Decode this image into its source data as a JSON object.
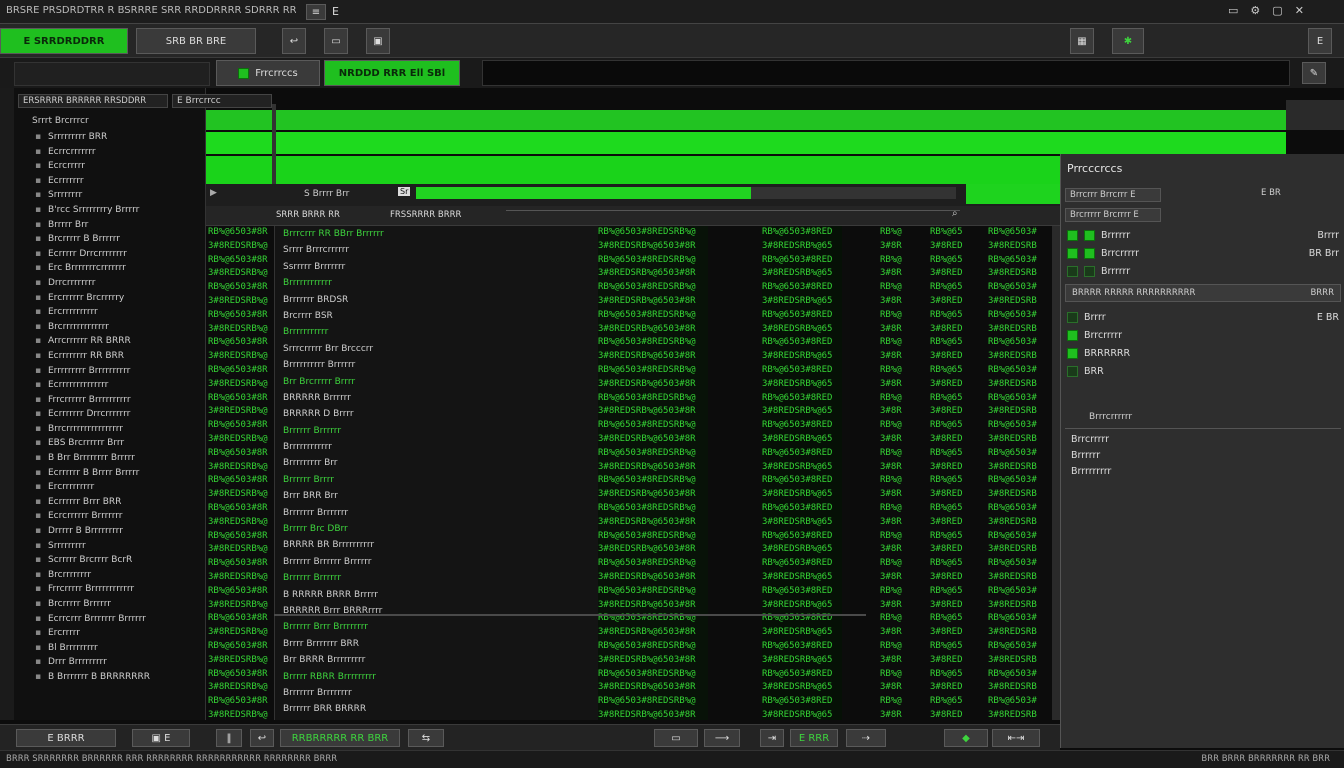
{
  "window": {
    "title": "BRSRE PRSDRDTRR R BSRRRE SRR RRDDRRRR SDRRR RRRBRR",
    "menu_extra": "E"
  },
  "toolbar": {
    "primary_label": "E SRRDRDDRR",
    "search_label": "SRB BR BRE",
    "zoom_label": "E"
  },
  "tabs": [
    {
      "label": "Frrcrrccs"
    },
    {
      "label": "NRDDD RRR Ell SBl"
    }
  ],
  "left_panel": {
    "header": "ERSRRRR BRRRRR RRSDDRR",
    "header_right": "E Brrcrrcc",
    "subheader": "Srrrt Brcrrrcr",
    "items": [
      "Srrrrrrrrr BRR",
      "Ecrrcrrrrrrr",
      "Ecrcrrrrr",
      "Ecrrrrrrr",
      "Srrrrrrrr",
      "B'rcc Srrrrrrrry Brrrrr",
      "Brrrrr Brr",
      "Brcrrrrr B Brrrrrr",
      "Ecrrrrr Drrcrrrrrrrr",
      "Erc Brrrrrrrcrrrrrrr",
      "Drrcrrrrrrrr",
      "Ercrrrrrr Brcrrrrry",
      "Ercrrrrrrrrrr",
      "Brcrrrrrrrrrrrrr",
      "Arrcrrrrrr RR BRRR",
      "Ecrrrrrrrr RR BRR",
      "Errrrrrrrr Brrrrrrrrrr",
      "Ecrrrrrrrrrrrrrr",
      "Frrcrrrrrr Brrrrrrrrrr",
      "Ecrrrrrrr Drrcrrrrrrr",
      "Brrcrrrrrrrrrrrrrrrr",
      "EBS Brcrrrrrr Brrr",
      "B Brr Brrrrrrrr Brrrrr",
      "Ecrrrrrr B Brrrr Brrrrr",
      "Ercrrrrrrrrr",
      "Ecrrrrrr Brrr BRR",
      "Ecrcrrrrrr Brrrrrrr",
      "Drrrrr B Brrrrrrrrr",
      "Srrrrrrrrr",
      "Scrrrrr Brcrrrr BcrR",
      "Brcrrrrrrrr",
      "Frrcrrrrr Brrrrrrrrrrrr",
      "Brcrrrrr Brrrrrr",
      "Ecrrcrrr Brrrrrrr Brrrrrr",
      "Ercrrrrr",
      "Bl Brrrrrrrrr",
      "Drrr Brrrrrrrrr",
      "B Brrrrrrr B BRRRRRRR"
    ]
  },
  "progress": {
    "label": "S Brrrr Brr",
    "value": 0.62,
    "left_label": "Sr"
  },
  "center": {
    "sort_label": "SRRR BRRR RR",
    "filter_label": "FRSSRRRR BRRR",
    "rows": [
      "Brrrcrrr RR BBrr Brrrrrr",
      "Srrrr Brrrcrrrrrr",
      "Ssrrrrr Brrrrrrr",
      "Brrrrrrrrrrrr",
      "Brrrrrrr BRDSR",
      "Brcrrrr BSR",
      "Brrrrrrrrrrr",
      "Srrrcrrrrr Brr Brcccrr",
      "Brrrrrrrrrr Brrrrrr",
      "Brr Brcrrrrr Brrrr",
      "BRRRRR Brrrrrr",
      "BRRRRR D Brrrr",
      "Brrrrrr Brrrrrr",
      "Brrrrrrrrrrrr",
      "Brrrrrrrrr Brr",
      "Brrrrrr Brrrr",
      "Brrr BRR Brr",
      "Brrrrrrr Brrrrrrr",
      "Brrrrr Brc DBrr",
      "BRRRR BR Brrrrrrrrrr",
      "Brrrrrr Brrrrrr Brrrrrr",
      "Brrrrrr Brrrrrr",
      "B RRRRR BRRR Brrrrr",
      "BRRRRR Brrr BRRRrrrr",
      "Brrrrrr Brrr Brrrrrrrr",
      "Brrrr Brrrrrrr BRR",
      "Brr BRRR Brrrrrrrrr",
      "Brrrrr RBRR Brrrrrrrrr",
      "Brrrrrrr Brrrrrrrr",
      "Brrrrrr BRR BRRRR"
    ]
  },
  "right_panel": {
    "title": "Prrcccrccs",
    "subtitle": "Brrcrrr Brrcrrr E",
    "subtitle_right": "E BR",
    "section": "Brcrrrrr Brcrrrr E",
    "rows": [
      {
        "label": "Brrrrrr",
        "value": "Brrrr",
        "on": true
      },
      {
        "label": "Brrcrrrrr",
        "value": "BR Brr",
        "on": true
      },
      {
        "label": "Brrrrrr",
        "value": "",
        "on": false
      }
    ],
    "path_label": "BRRRR RRRRR RRRRRRRRRR",
    "path_value": "BRRR",
    "options": [
      {
        "label": "Brrrr",
        "value": "E BR",
        "on": false
      },
      {
        "label": "Brrcrrrrr",
        "value": "",
        "on": true
      },
      {
        "label": "BRRRRRR",
        "value": "",
        "on": true
      },
      {
        "label": "BRR",
        "value": "",
        "on": false
      }
    ],
    "group_label": "Brrrcrrrrrr",
    "group_items": [
      "Brrcrrrrr",
      "Brrrrrr",
      "Brrrrrrrrr"
    ]
  },
  "bottom": {
    "left_label": "E BRRR",
    "mid_label": "RRBRRRRR RR BRR",
    "status_left": "BRRR SRRRRRRR BRRRRRR RRR RRRRRRRR RRRRRRRRRRR RRRRRRRR BRRR",
    "status_right": "BRR BRRR BRRRRRRR RR BRR",
    "green_tag": "E RRR"
  }
}
